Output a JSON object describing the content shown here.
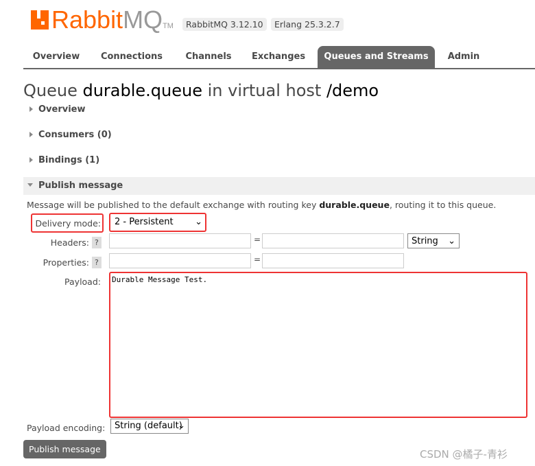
{
  "logo": {
    "brand": "Rabbit",
    "brand2": "MQ",
    "tm": "TM"
  },
  "versions": {
    "rabbitmq": "RabbitMQ 3.12.10",
    "erlang": "Erlang 25.3.2.7"
  },
  "nav": [
    "Overview",
    "Connections",
    "Channels",
    "Exchanges",
    "Queues and Streams",
    "Admin"
  ],
  "title": {
    "prefix": "Queue",
    "queue": "durable.queue",
    "mid": "in virtual host",
    "vhost": "/demo"
  },
  "sections": {
    "overview": "Overview",
    "consumers": "Consumers (0)",
    "bindings": "Bindings (1)",
    "publish": "Publish message"
  },
  "publish": {
    "info_pre": "Message will be published to the default exchange with routing key ",
    "info_key": "durable.queue",
    "info_post": ", routing it to this queue.",
    "delivery_label": "Delivery mode:",
    "delivery_value": "2 - Persistent",
    "headers_label": "Headers:",
    "properties_label": "Properties:",
    "help": "?",
    "eq": "=",
    "header_type": "String",
    "payload_label": "Payload:",
    "payload": "Durable Message Test.",
    "encoding_label": "Payload encoding:",
    "encoding_value": "String (default)",
    "button": "Publish message"
  },
  "watermark": "CSDN @橘子-青衫"
}
